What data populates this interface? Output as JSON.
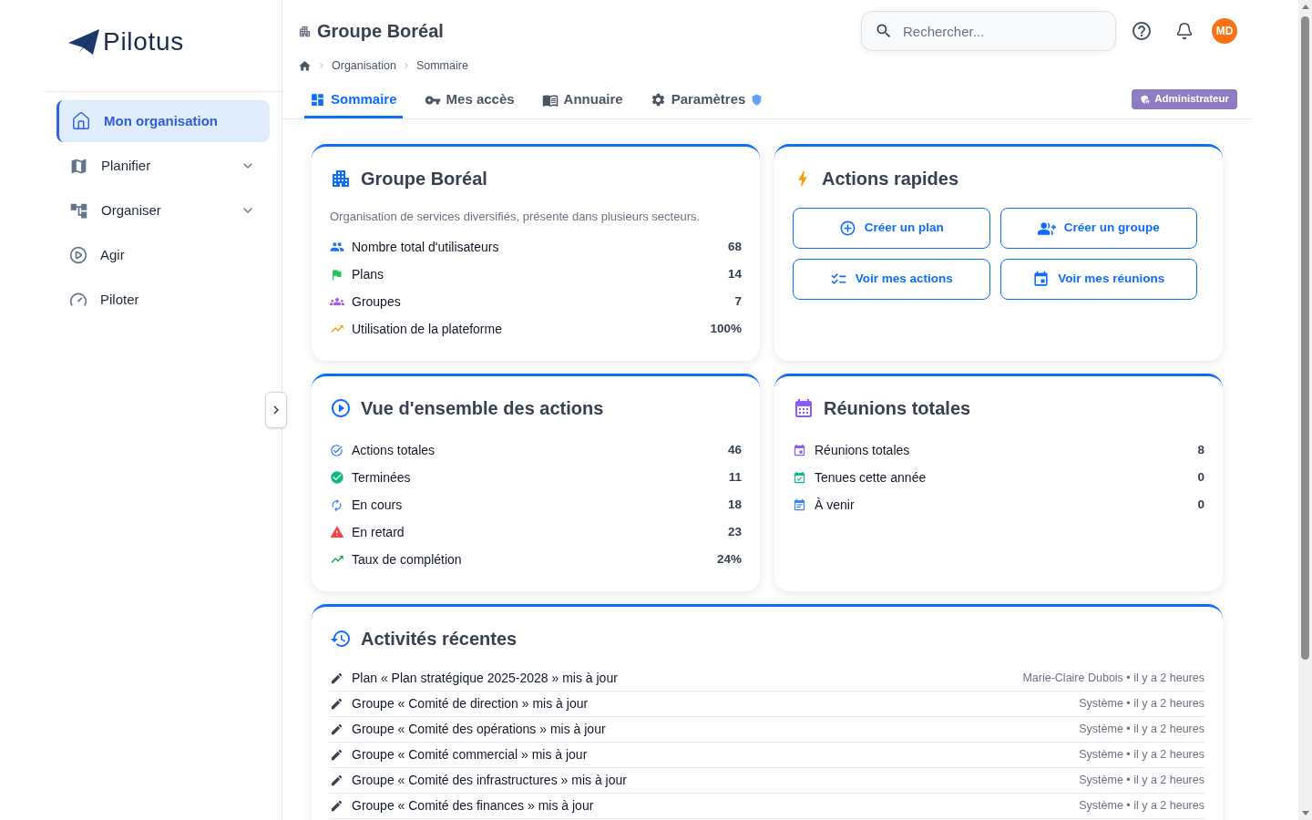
{
  "sidebar": {
    "logo": "Pilotus",
    "items": [
      {
        "label": "Mon organisation",
        "selected": true,
        "has_submenu": false
      },
      {
        "label": "Planifier",
        "selected": false,
        "has_submenu": true
      },
      {
        "label": "Organiser",
        "selected": false,
        "has_submenu": true
      },
      {
        "label": "Agir",
        "selected": false,
        "has_submenu": false
      },
      {
        "label": "Piloter",
        "selected": false,
        "has_submenu": false
      }
    ]
  },
  "header": {
    "title": "Groupe Boréal",
    "search": {
      "placeholder": "Rechercher..."
    },
    "avatar": "MD",
    "breadcrumb": [
      "Organisation",
      "Sommaire"
    ],
    "tabs": [
      {
        "label": "Sommaire",
        "selected": true,
        "admin_only": false
      },
      {
        "label": "Mes accès",
        "selected": false,
        "admin_only": false
      },
      {
        "label": "Annuaire",
        "selected": false,
        "admin_only": false
      },
      {
        "label": "Paramètres",
        "selected": false,
        "admin_only": true
      }
    ],
    "role_badge": "Administrateur"
  },
  "organization": {
    "title": "Groupe Boréal",
    "description": "Organisation de services diversifiés, présente dans plusieurs secteurs.",
    "stats": [
      {
        "label": "Nombre total d'utilisateurs",
        "value": "68"
      },
      {
        "label": "Plans",
        "value": "14"
      },
      {
        "label": "Groupes",
        "value": "7"
      },
      {
        "label": "Utilisation de la plateforme",
        "value": "100%"
      }
    ]
  },
  "quick_actions": {
    "title": "Actions rapides",
    "buttons": [
      "Créer un plan",
      "Créer un groupe",
      "Voir mes actions",
      "Voir mes réunions"
    ]
  },
  "actions_overview": {
    "title": "Vue d'ensemble des actions",
    "stats": [
      {
        "label": "Actions totales",
        "value": "46"
      },
      {
        "label": "Terminées",
        "value": "11"
      },
      {
        "label": "En cours",
        "value": "18"
      },
      {
        "label": "En retard",
        "value": "23"
      },
      {
        "label": "Taux de complétion",
        "value": "24%"
      }
    ]
  },
  "meetings": {
    "title": "Réunions totales",
    "stats": [
      {
        "label": "Réunions totales",
        "value": "8"
      },
      {
        "label": "Tenues cette année",
        "value": "0"
      },
      {
        "label": "À venir",
        "value": "0"
      }
    ]
  },
  "recent_activity": {
    "title": "Activités récentes",
    "items": [
      {
        "text": "Plan « Plan stratégique 2025-2028 » mis à jour",
        "meta": "Marie-Claire Dubois • il y a 2 heures"
      },
      {
        "text": "Groupe « Comité de direction » mis à jour",
        "meta": "Système • il y a 2 heures"
      },
      {
        "text": "Groupe « Comité des opérations » mis à jour",
        "meta": "Système • il y a 2 heures"
      },
      {
        "text": "Groupe « Comité commercial » mis à jour",
        "meta": "Système • il y a 2 heures"
      },
      {
        "text": "Groupe « Comité des infrastructures » mis à jour",
        "meta": "Système • il y a 2 heures"
      },
      {
        "text": "Groupe « Comité des finances » mis à jour",
        "meta": "Système • il y a 2 heures"
      }
    ]
  }
}
